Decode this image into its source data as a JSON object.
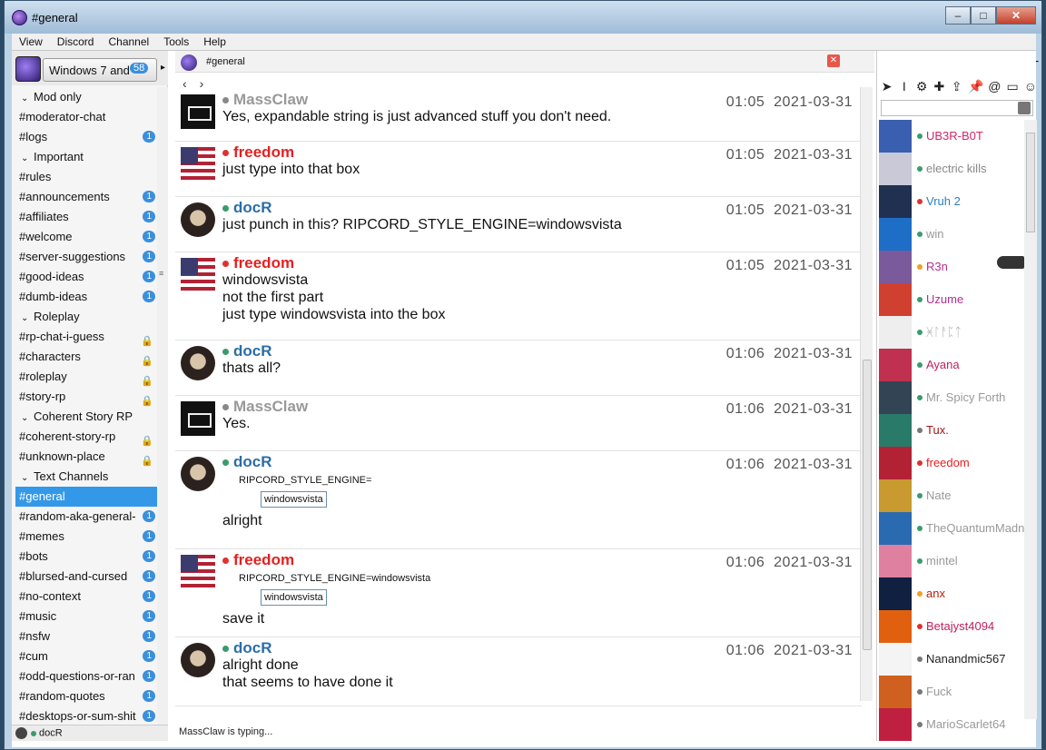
{
  "window": {
    "title": "#general",
    "controls": [
      "–",
      "□",
      "✕"
    ]
  },
  "menu": [
    "View",
    "Discord",
    "Channel",
    "Tools",
    "Help"
  ],
  "server": {
    "name": "Windows 7 and",
    "unread": "58"
  },
  "channels": [
    {
      "label": "Mod only",
      "kind": "category"
    },
    {
      "label": "#moderator-chat"
    },
    {
      "label": "#logs",
      "badge": "1"
    },
    {
      "label": "Important",
      "kind": "category"
    },
    {
      "label": "#rules"
    },
    {
      "label": "#announcements",
      "badge": "1"
    },
    {
      "label": "#affiliates",
      "badge": "1"
    },
    {
      "label": "#welcome",
      "badge": "1"
    },
    {
      "label": "#server-suggestions",
      "badge": "1"
    },
    {
      "label": "#good-ideas",
      "badge": "1"
    },
    {
      "label": "#dumb-ideas",
      "badge": "1"
    },
    {
      "label": "Roleplay",
      "kind": "category"
    },
    {
      "label": "#rp-chat-i-guess",
      "locked": true
    },
    {
      "label": "#characters",
      "locked": true
    },
    {
      "label": "#roleplay",
      "locked": true
    },
    {
      "label": "#story-rp",
      "locked": true
    },
    {
      "label": "Coherent Story RP",
      "kind": "category"
    },
    {
      "label": "#coherent-story-rp",
      "locked": true
    },
    {
      "label": "#unknown-place",
      "locked": true
    },
    {
      "label": "Text Channels",
      "kind": "category"
    },
    {
      "label": "#general",
      "selected": true
    },
    {
      "label": "#random-aka-general-",
      "badge": "1"
    },
    {
      "label": "#memes",
      "badge": "1"
    },
    {
      "label": "#bots",
      "badge": "1"
    },
    {
      "label": "#blursed-and-cursed",
      "badge": "1"
    },
    {
      "label": "#no-context",
      "badge": "1"
    },
    {
      "label": "#music",
      "badge": "1"
    },
    {
      "label": "#nsfw",
      "badge": "1"
    },
    {
      "label": "#cum",
      "badge": "1"
    },
    {
      "label": "#odd-questions-or-ran",
      "badge": "1"
    },
    {
      "label": "#random-quotes",
      "badge": "1"
    },
    {
      "label": "#desktops-or-sum-shit",
      "badge": "1"
    }
  ],
  "current_user": {
    "name": "docR"
  },
  "tab": {
    "label": "#general"
  },
  "messages": [
    {
      "author": "MassClaw",
      "color": "grey",
      "avatar": "mass",
      "time": "01:05",
      "date": "2021-03-31",
      "lines": [
        "Yes, expandable string is just advanced stuff you don't need."
      ]
    },
    {
      "author": "freedom",
      "color": "red",
      "avatar": "flag",
      "time": "01:05",
      "date": "2021-03-31",
      "lines": [
        "just type into that box"
      ]
    },
    {
      "author": "docR",
      "color": "teal",
      "avatar": "doc",
      "time": "01:05",
      "date": "2021-03-31",
      "lines": [
        "just punch in this? RIPCORD_STYLE_ENGINE=windowsvista"
      ]
    },
    {
      "author": "freedom",
      "color": "red",
      "avatar": "flag",
      "time": "01:05",
      "date": "2021-03-31",
      "lines": [
        "windowsvista",
        "not the first part",
        "just type windowsvista into the box"
      ]
    },
    {
      "author": "docR",
      "color": "teal",
      "avatar": "doc",
      "time": "01:06",
      "date": "2021-03-31",
      "lines": [
        "thats all?"
      ]
    },
    {
      "author": "MassClaw",
      "color": "grey",
      "avatar": "mass",
      "time": "01:06",
      "date": "2021-03-31",
      "lines": [
        "Yes."
      ]
    },
    {
      "author": "docR",
      "color": "teal",
      "avatar": "doc",
      "time": "01:06",
      "date": "2021-03-31",
      "tree": [
        "RIPCORD_STYLE_ENGINE=",
        "windowsvista"
      ],
      "lines": [
        "alright"
      ]
    },
    {
      "author": "freedom",
      "color": "red",
      "avatar": "flag",
      "time": "01:06",
      "date": "2021-03-31",
      "tree": [
        "RIPCORD_STYLE_ENGINE=windowsvista",
        "windowsvista"
      ],
      "lines": [
        "save it"
      ]
    },
    {
      "author": "docR",
      "color": "teal",
      "avatar": "doc",
      "time": "01:06",
      "date": "2021-03-31",
      "lines": [
        "alright done",
        "that seems to have done it"
      ]
    }
  ],
  "typing": "MassClaw is typing...",
  "members": [
    {
      "name": "UB3R-B0T",
      "color": "#d4256a",
      "status": "#3a9b6c",
      "av": "#3a5fb0"
    },
    {
      "name": "electric kills",
      "color": "#888888",
      "status": "#3a9b6c",
      "av": "#c9c9d8"
    },
    {
      "name": "Vruh 2",
      "color": "#2b7fbf",
      "status": "#e03030",
      "av": "#203050"
    },
    {
      "name": "win",
      "color": "#999999",
      "status": "#3a9b6c",
      "av": "#1e6ec8"
    },
    {
      "name": "R3n",
      "color": "#b03090",
      "status": "#f0a020",
      "av": "#7a5a9a"
    },
    {
      "name": "Uzume",
      "color": "#b03090",
      "status": "#3a9b6c",
      "av": "#d04030"
    },
    {
      "name": "ᚸᛚᚨᛈᛏ",
      "color": "#aaaaaa",
      "status": "#3a9b6c",
      "av": "#eeeeee"
    },
    {
      "name": "Ayana",
      "color": "#c02060",
      "status": "#3a9b6c",
      "av": "#c03050"
    },
    {
      "name": "Mr. Spicy Forth",
      "color": "#999999",
      "status": "#3a9b6c",
      "av": "#334455"
    },
    {
      "name": "Tux.",
      "color": "#a01818",
      "status": "#777777",
      "av": "#2a7a6a"
    },
    {
      "name": "freedom",
      "color": "#e52020",
      "status": "#e03030",
      "av": "#b22234"
    },
    {
      "name": "Nate",
      "color": "#999999",
      "status": "#3a9b6c",
      "av": "#c89a30"
    },
    {
      "name": "TheQuantumMadne",
      "color": "#999999",
      "status": "#3a9b6c",
      "av": "#2a6ab0"
    },
    {
      "name": "mintel",
      "color": "#999999",
      "status": "#3a9b6c",
      "av": "#e080a0"
    },
    {
      "name": "anx",
      "color": "#b8200a",
      "status": "#f0a020",
      "av": "#102040"
    },
    {
      "name": "Betajyst4094",
      "color": "#c02060",
      "status": "#e03030",
      "av": "#e06010"
    },
    {
      "name": "Nanandmic567",
      "color": "#222222",
      "status": "#777777",
      "av": "#f4f4f4"
    },
    {
      "name": "Fuck",
      "color": "#999999",
      "status": "#777777",
      "av": "#d06020"
    },
    {
      "name": "MarioScarlet64",
      "color": "#999999",
      "status": "#777777",
      "av": "#c02040"
    }
  ]
}
